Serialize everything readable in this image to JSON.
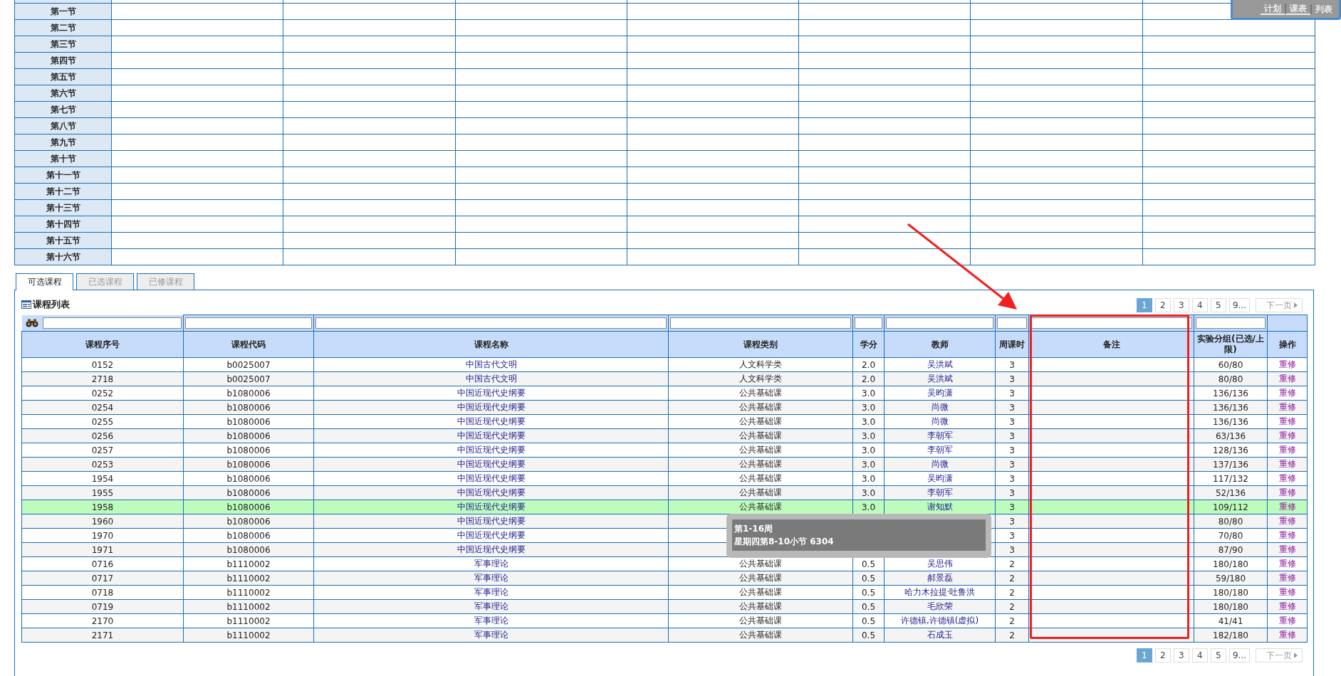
{
  "view_switch": [
    "计划",
    "课表",
    "列表"
  ],
  "schedule": {
    "periods": [
      "第一节",
      "第二节",
      "第三节",
      "第四节",
      "第五节",
      "第六节",
      "第七节",
      "第八节",
      "第九节",
      "第十节",
      "第十一节",
      "第十二节",
      "第十三节",
      "第十四节",
      "第十五节",
      "第十六节"
    ]
  },
  "tabs": [
    {
      "label": "可选课程",
      "selected": true
    },
    {
      "label": "已选课程",
      "selected": false
    },
    {
      "label": "已修课程",
      "selected": false
    }
  ],
  "panel_title": "课程列表",
  "pagination": {
    "pages": [
      {
        "label": "1",
        "selected": true
      },
      {
        "label": "2",
        "selected": false
      },
      {
        "label": "3",
        "selected": false
      },
      {
        "label": "4",
        "selected": false
      },
      {
        "label": "5",
        "selected": false
      },
      {
        "label": "9...",
        "selected": false
      }
    ],
    "next": "下一页"
  },
  "bottom_pagination": {
    "pages": [
      {
        "label": "1",
        "selected": true
      },
      {
        "label": "2",
        "selected": false
      },
      {
        "label": "3",
        "selected": false
      },
      {
        "label": "4",
        "selected": false
      },
      {
        "label": "5",
        "selected": false
      },
      {
        "label": "9...",
        "selected": false
      }
    ],
    "next": "下一页"
  },
  "table": {
    "columns": [
      "课程序号",
      "课程代码",
      "课程名称",
      "课程类别",
      "学分",
      "教师",
      "周课时",
      "备注",
      "实验分组(已选/上限)",
      "操作"
    ],
    "rows": [
      {
        "seq": "0152",
        "code": "b0025007",
        "name": "中国古代文明",
        "category": "人文科学类",
        "credit": "2.0",
        "teacher": "吴洪斌",
        "hours": "3",
        "group": "60/80",
        "action": "重修",
        "highlighted": false
      },
      {
        "seq": "2718",
        "code": "b0025007",
        "name": "中国古代文明",
        "category": "人文科学类",
        "credit": "2.0",
        "teacher": "吴洪斌",
        "hours": "3",
        "group": "80/80",
        "action": "重修",
        "highlighted": false
      },
      {
        "seq": "0252",
        "code": "b1080006",
        "name": "中国近现代史纲要",
        "category": "公共基础课",
        "credit": "3.0",
        "teacher": "吴昀潇",
        "hours": "3",
        "group": "136/136",
        "action": "重修",
        "highlighted": false
      },
      {
        "seq": "0254",
        "code": "b1080006",
        "name": "中国近现代史纲要",
        "category": "公共基础课",
        "credit": "3.0",
        "teacher": "尚微",
        "hours": "3",
        "group": "136/136",
        "action": "重修",
        "highlighted": false
      },
      {
        "seq": "0255",
        "code": "b1080006",
        "name": "中国近现代史纲要",
        "category": "公共基础课",
        "credit": "3.0",
        "teacher": "尚微",
        "hours": "3",
        "group": "136/136",
        "action": "重修",
        "highlighted": false
      },
      {
        "seq": "0256",
        "code": "b1080006",
        "name": "中国近现代史纲要",
        "category": "公共基础课",
        "credit": "3.0",
        "teacher": "李朝军",
        "hours": "3",
        "group": "63/136",
        "action": "重修",
        "highlighted": false
      },
      {
        "seq": "0257",
        "code": "b1080006",
        "name": "中国近现代史纲要",
        "category": "公共基础课",
        "credit": "3.0",
        "teacher": "李朝军",
        "hours": "3",
        "group": "128/136",
        "action": "重修",
        "highlighted": false
      },
      {
        "seq": "0253",
        "code": "b1080006",
        "name": "中国近现代史纲要",
        "category": "公共基础课",
        "credit": "3.0",
        "teacher": "尚微",
        "hours": "3",
        "group": "137/136",
        "action": "重修",
        "highlighted": false
      },
      {
        "seq": "1954",
        "code": "b1080006",
        "name": "中国近现代史纲要",
        "category": "公共基础课",
        "credit": "3.0",
        "teacher": "吴昀潇",
        "hours": "3",
        "group": "117/132",
        "action": "重修",
        "highlighted": false
      },
      {
        "seq": "1955",
        "code": "b1080006",
        "name": "中国近现代史纲要",
        "category": "公共基础课",
        "credit": "3.0",
        "teacher": "李朝军",
        "hours": "3",
        "group": "52/136",
        "action": "重修",
        "highlighted": false
      },
      {
        "seq": "1958",
        "code": "b1080006",
        "name": "中国近现代史纲要",
        "category": "公共基础课",
        "credit": "3.0",
        "teacher": "谢知默",
        "hours": "3",
        "group": "109/112",
        "action": "重修",
        "highlighted": true
      },
      {
        "seq": "1960",
        "code": "b1080006",
        "name": "中国近现代史纲要",
        "hours": "3",
        "group": "80/80",
        "action": "重修",
        "highlighted": false
      },
      {
        "seq": "1970",
        "code": "b1080006",
        "name": "中国近现代史纲要",
        "hours": "3",
        "group": "70/80",
        "action": "重修",
        "highlighted": false
      },
      {
        "seq": "1971",
        "code": "b1080006",
        "name": "中国近现代史纲要",
        "hours": "3",
        "group": "87/90",
        "action": "重修",
        "highlighted": false
      },
      {
        "seq": "0716",
        "code": "b1110002",
        "name": "军事理论",
        "category": "公共基础课",
        "credit": "0.5",
        "teacher": "吴思伟",
        "hours": "2",
        "group": "180/180",
        "action": "重修",
        "highlighted": false
      },
      {
        "seq": "0717",
        "code": "b1110002",
        "name": "军事理论",
        "category": "公共基础课",
        "credit": "0.5",
        "teacher": "郝景磊",
        "hours": "2",
        "group": "59/180",
        "action": "重修",
        "highlighted": false
      },
      {
        "seq": "0718",
        "code": "b1110002",
        "name": "军事理论",
        "category": "公共基础课",
        "credit": "0.5",
        "teacher": "哈力木拉提·吐鲁洪",
        "hours": "2",
        "group": "180/180",
        "action": "重修",
        "highlighted": false
      },
      {
        "seq": "0719",
        "code": "b1110002",
        "name": "军事理论",
        "category": "公共基础课",
        "credit": "0.5",
        "teacher": "毛欣荣",
        "hours": "2",
        "group": "180/180",
        "action": "重修",
        "highlighted": false
      },
      {
        "seq": "2170",
        "code": "b1110002",
        "name": "军事理论",
        "category": "公共基础课",
        "credit": "0.5",
        "teacher": "许德镇,许德镇(虚拟)",
        "hours": "2",
        "group": "41/41",
        "action": "重修",
        "highlighted": false
      },
      {
        "seq": "2171",
        "code": "b1110002",
        "name": "军事理论",
        "category": "公共基础课",
        "credit": "0.5",
        "teacher": "石成玉",
        "hours": "2",
        "group": "182/180",
        "action": "重修",
        "highlighted": false
      }
    ]
  },
  "tooltip": {
    "lines": [
      "第1-16周",
      "星期四第8-10小节 6304"
    ]
  }
}
